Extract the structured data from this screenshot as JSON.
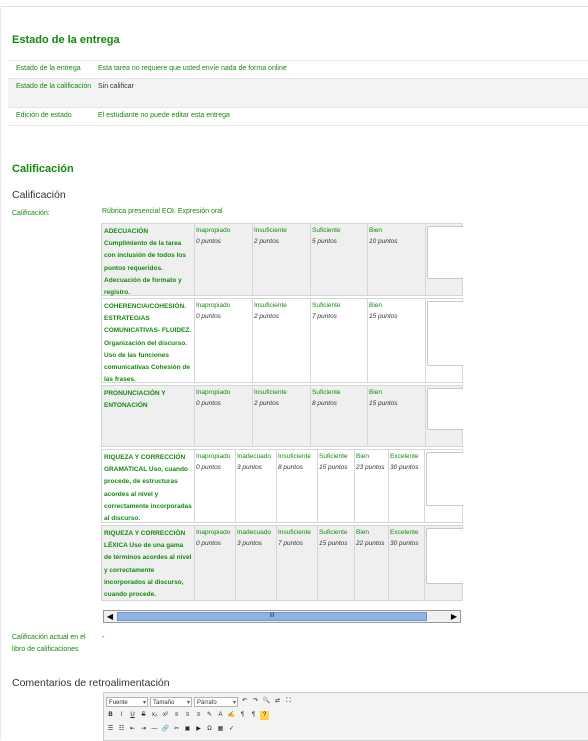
{
  "status": {
    "heading": "Estado de la entrega",
    "rows": [
      {
        "label": "Estado de la entrega",
        "value": "Esta tarea no requiere que usted envíe nada de forma online"
      },
      {
        "label": "Estado de la calificación",
        "value": "Sin calificar"
      },
      {
        "label": "Edición de estado",
        "value": "El estudiante no puede editar esta entrega"
      }
    ]
  },
  "grading": {
    "heading": "Calificación",
    "subheading": "Calificación",
    "field_label": "Calificación:",
    "rubric_name": "Rúbrica presencial EOI. Expresión oral",
    "criteria": [
      {
        "description": "ADECUACIÓN Cumplimiento de la tarea con inclusión de todos los puntos requeridos. Adecuación de formato y registro.",
        "levels": [
          {
            "label": "Inapropiado",
            "points": "0 puntos"
          },
          {
            "label": "Insuficiente",
            "points": "2 puntos"
          },
          {
            "label": "Suficiente",
            "points": "5 puntos"
          },
          {
            "label": "Bien",
            "points": "10 puntos"
          }
        ]
      },
      {
        "description": "COHERENCIA/COHESIÓN. ESTRATEGIAS COMUNICATIVAS- FLUIDEZ. Organización del discurso. Uso de las funciones comunicativas Cohesión de las frases.",
        "levels": [
          {
            "label": "Inapropiado",
            "points": "0 puntos"
          },
          {
            "label": "Insuficiente",
            "points": "2 puntos"
          },
          {
            "label": "Suficiente",
            "points": "7 puntos"
          },
          {
            "label": "Bien",
            "points": "15 puntos"
          }
        ]
      },
      {
        "description": "PRONUNCIACIÓN Y ENTONACIÓN",
        "levels": [
          {
            "label": "Inapropiado",
            "points": "0 puntos"
          },
          {
            "label": "Insuficiente",
            "points": "2 puntos"
          },
          {
            "label": "Suficiente",
            "points": "8 puntos"
          },
          {
            "label": "Bien",
            "points": "15 puntos"
          }
        ]
      },
      {
        "description": "RIQUEZA Y CORRECCIÓN GRAMATICAL Uso, cuando procede, de estructuras acordes al nivel y correctamente incorporadas al discurso.",
        "levels": [
          {
            "label": "Inapropiado",
            "points": "0 puntos"
          },
          {
            "label": "Inadecuado",
            "points": "3 puntos"
          },
          {
            "label": "Insuficiente",
            "points": "8 puntos"
          },
          {
            "label": "Suficiente",
            "points": "15 puntos"
          },
          {
            "label": "Bien",
            "points": "23 puntos"
          },
          {
            "label": "Excelente",
            "points": "30 puntos"
          }
        ]
      },
      {
        "description": "RIQUEZA Y CORRECCIÓN LÉXICA Uso de una gama de términos acordes al nivel y correctamente incorporados al discurso, cuando procede.",
        "levels": [
          {
            "label": "Inapropiado",
            "points": "0 puntos"
          },
          {
            "label": "Inadecuado",
            "points": "3 puntos"
          },
          {
            "label": "Insuficiente",
            "points": "7 puntos"
          },
          {
            "label": "Suficiente",
            "points": "15 puntos"
          },
          {
            "label": "Bien",
            "points": "22 puntos"
          },
          {
            "label": "Excelente",
            "points": "30 puntos"
          }
        ]
      }
    ],
    "current_grade_label": "Calificación actual en el libro de calificaciones",
    "current_grade_value": "-",
    "scroll_thumb_glyph": "III"
  },
  "feedback": {
    "heading": "Comentarios de retroalimentación",
    "font_select": "Fuente",
    "size_select": "Tamaño",
    "format_select": "Párrafo"
  },
  "colors": {
    "accent_green": "#14890f",
    "scroll_blue": "#8db2e3"
  }
}
